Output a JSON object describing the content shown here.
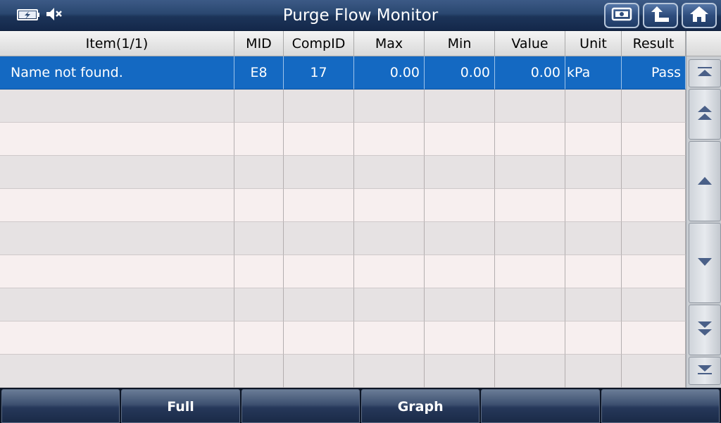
{
  "header": {
    "title": "Purge Flow Monitor",
    "status_icons": [
      "battery-charging-icon",
      "speaker-muted-icon"
    ],
    "buttons": [
      "screenshot-icon",
      "back-arrow-icon",
      "home-icon"
    ]
  },
  "table": {
    "columns": [
      {
        "label": "Item(1/1)"
      },
      {
        "label": "MID"
      },
      {
        "label": "CompID"
      },
      {
        "label": "Max"
      },
      {
        "label": "Min"
      },
      {
        "label": "Value"
      },
      {
        "label": "Unit"
      },
      {
        "label": "Result"
      }
    ],
    "rows": [
      {
        "cells": [
          "Name not found.",
          "E8",
          "17",
          "0.00",
          "0.00",
          "0.00",
          "kPa",
          "Pass"
        ],
        "selected": true
      },
      {
        "cells": [
          "",
          "",
          "",
          "",
          "",
          "",
          "",
          ""
        ],
        "selected": false
      },
      {
        "cells": [
          "",
          "",
          "",
          "",
          "",
          "",
          "",
          ""
        ],
        "selected": false
      },
      {
        "cells": [
          "",
          "",
          "",
          "",
          "",
          "",
          "",
          ""
        ],
        "selected": false
      },
      {
        "cells": [
          "",
          "",
          "",
          "",
          "",
          "",
          "",
          ""
        ],
        "selected": false
      },
      {
        "cells": [
          "",
          "",
          "",
          "",
          "",
          "",
          "",
          ""
        ],
        "selected": false
      },
      {
        "cells": [
          "",
          "",
          "",
          "",
          "",
          "",
          "",
          ""
        ],
        "selected": false
      },
      {
        "cells": [
          "",
          "",
          "",
          "",
          "",
          "",
          "",
          ""
        ],
        "selected": false
      },
      {
        "cells": [
          "",
          "",
          "",
          "",
          "",
          "",
          "",
          ""
        ],
        "selected": false
      },
      {
        "cells": [
          "",
          "",
          "",
          "",
          "",
          "",
          "",
          ""
        ],
        "selected": false
      }
    ]
  },
  "scrollbar": {
    "buttons": [
      "scroll-to-top-icon",
      "page-up-icon",
      "line-up-icon",
      "line-down-icon",
      "page-down-icon",
      "scroll-to-bottom-icon"
    ]
  },
  "footer": {
    "buttons": [
      {
        "label": ""
      },
      {
        "label": "Full"
      },
      {
        "label": ""
      },
      {
        "label": "Graph"
      },
      {
        "label": ""
      },
      {
        "label": ""
      }
    ]
  },
  "colors": {
    "selected_row": "#1469c2",
    "title_bar": "#24406a",
    "row_even": "#e6e2e3",
    "row_odd": "#f7efef"
  }
}
